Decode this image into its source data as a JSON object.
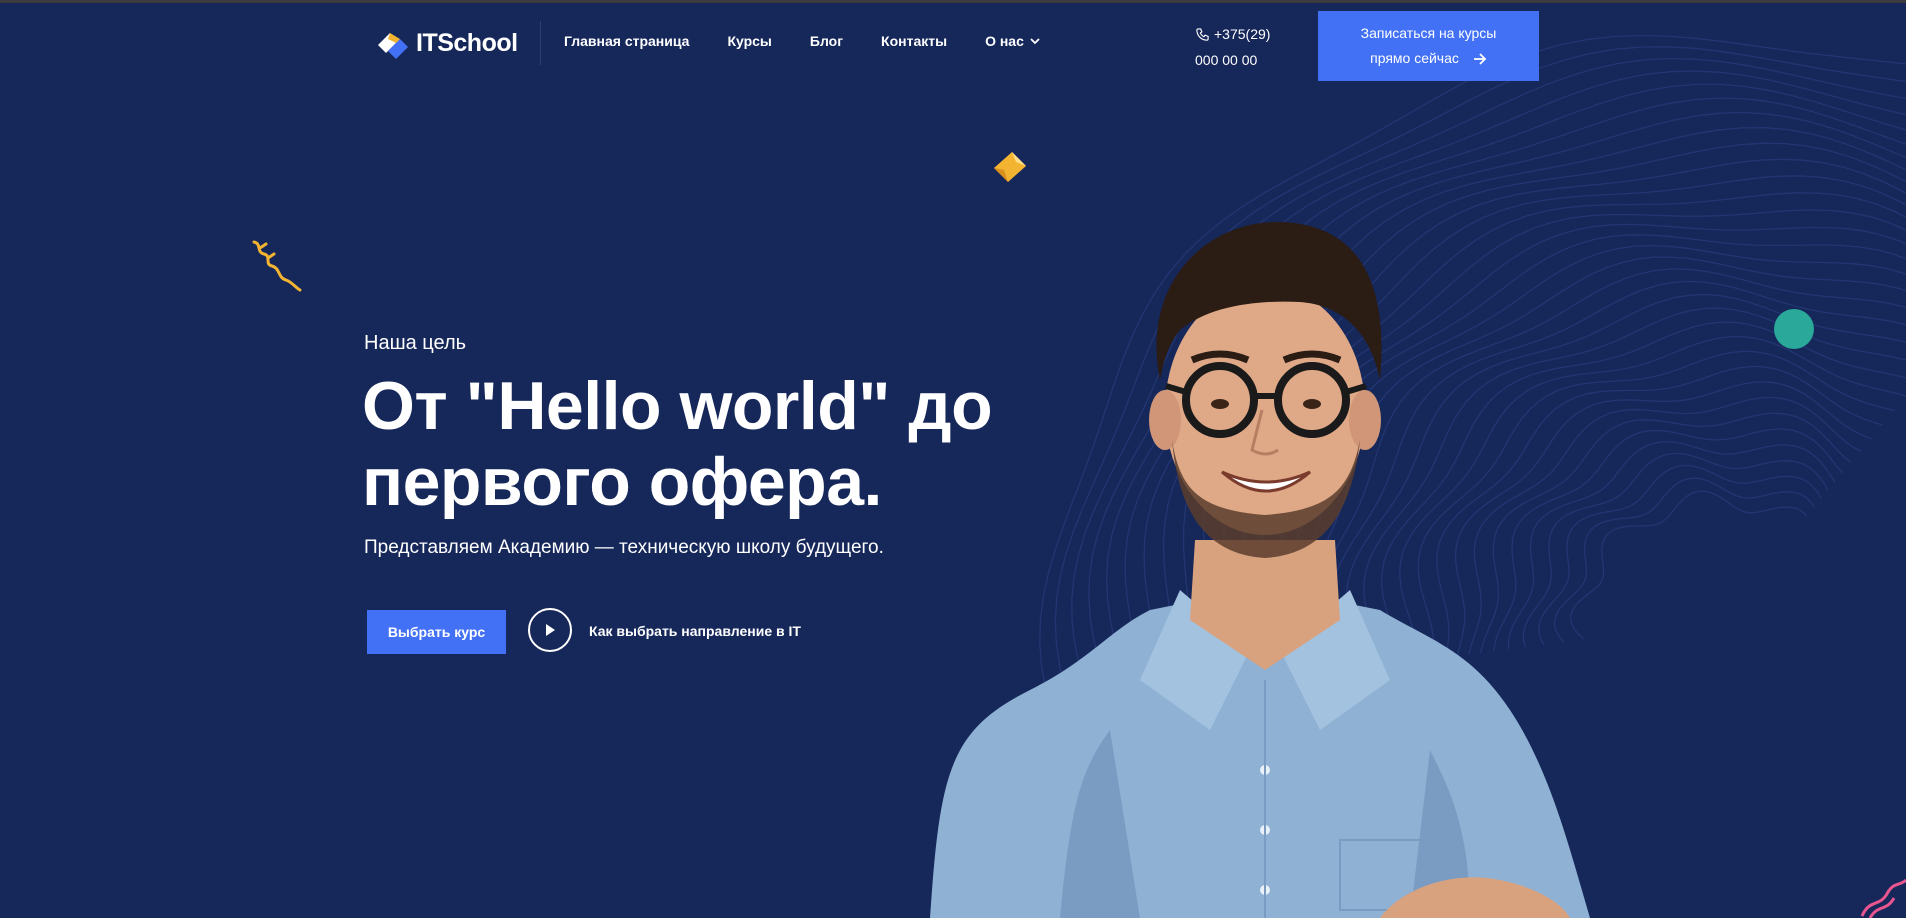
{
  "header": {
    "logo_text": "ITSchool",
    "nav": [
      {
        "label": "Главная страница"
      },
      {
        "label": "Курсы"
      },
      {
        "label": "Блог"
      },
      {
        "label": "Контакты"
      },
      {
        "label": "О нас",
        "has_dropdown": true
      }
    ],
    "phone_line1": "+375(29)",
    "phone_line2": "000 00 00",
    "cta_line1": "Записаться на курсы",
    "cta_line2": "прямо сейчас"
  },
  "hero": {
    "eyebrow": "Наша цель",
    "headline_line1": "От \"Hello world\" до",
    "headline_line2": "первого офера.",
    "subtitle": "Представляем Академию — техническую школу будущего.",
    "primary_button": "Выбрать курс",
    "video_link": "Как выбрать направление в IT"
  },
  "colors": {
    "background": "#16275a",
    "accent": "#4271f5",
    "teal": "#2aa89a",
    "yellow": "#f3b431"
  },
  "icons": {
    "phone": "phone-icon",
    "arrow": "arrow-right-icon",
    "play": "play-icon",
    "chevron": "chevron-down-icon"
  }
}
